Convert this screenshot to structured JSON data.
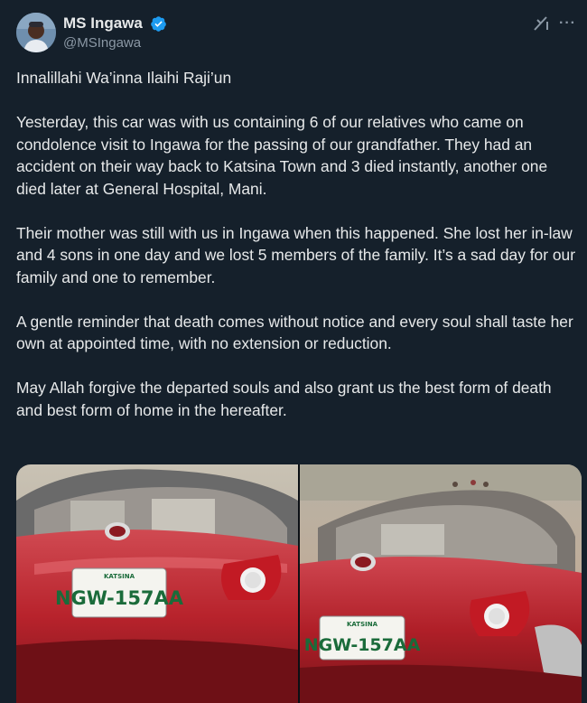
{
  "author": {
    "display_name": "MS Ingawa",
    "handle": "@MSIngawa",
    "verified": true,
    "icons": [
      "avatar",
      "verified-badge-icon",
      "grok-icon",
      "more-icon"
    ]
  },
  "tweet": {
    "paragraphs": [
      "Innalillahi Wa’inna Ilaihi Raji’un",
      "Yesterday, this car was with us containing 6 of our relatives who came on condolence visit to Ingawa for the passing of our grandfather. They had an accident on their way back to Katsina Town and 3 died instantly, another one died later at General Hospital, Mani.",
      "Their mother was still with us in Ingawa when this happened. She lost her in-law and 4 sons in one day and we lost 5 members of the family. It’s a sad day for our family and one to remember.",
      "A gentle reminder that death comes without notice and every soul shall taste her own at appointed time, with no extension or reduction.",
      "May Allah forgive the departed souls and also grant us the best form of death and best form of home in the hereafter."
    ]
  },
  "media": {
    "photos": [
      {
        "plate_state": "KATSINA",
        "plate_number": "NGW-157AA"
      },
      {
        "plate_state": "KATSINA",
        "plate_number": "NGW-157AA"
      }
    ]
  },
  "colors": {
    "background": "#15202b",
    "text": "#e7e9ea",
    "secondary": "#8b98a5",
    "verified": "#1d9bf0",
    "car_red": "#b8232c"
  }
}
